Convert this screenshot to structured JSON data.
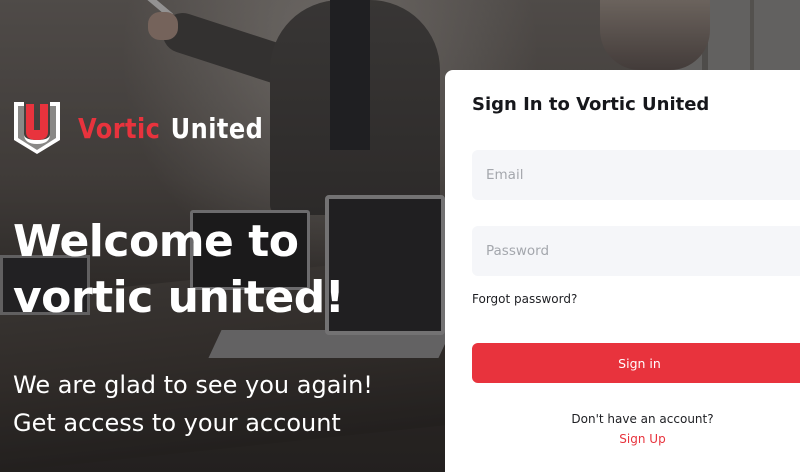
{
  "colors": {
    "brand_red": "#e8333d",
    "card_bg": "#ffffff",
    "field_bg": "#f5f6f9"
  },
  "brand": {
    "logo_icon": "shield-u-logo-icon",
    "name_part1": "Vortic",
    "name_part2": "United"
  },
  "hero": {
    "headline_line1": "Welcome to",
    "headline_line2": "vortic united!",
    "sub_line1": "We are glad to see you again!",
    "sub_line2": "Get access to your account"
  },
  "signin": {
    "title": "Sign In to Vortic United",
    "email_placeholder": "Email",
    "password_placeholder": "Password",
    "forgot_label": "Forgot password?",
    "submit_label": "Sign in",
    "no_account_text": "Don't have an account?",
    "signup_label": "Sign Up"
  }
}
